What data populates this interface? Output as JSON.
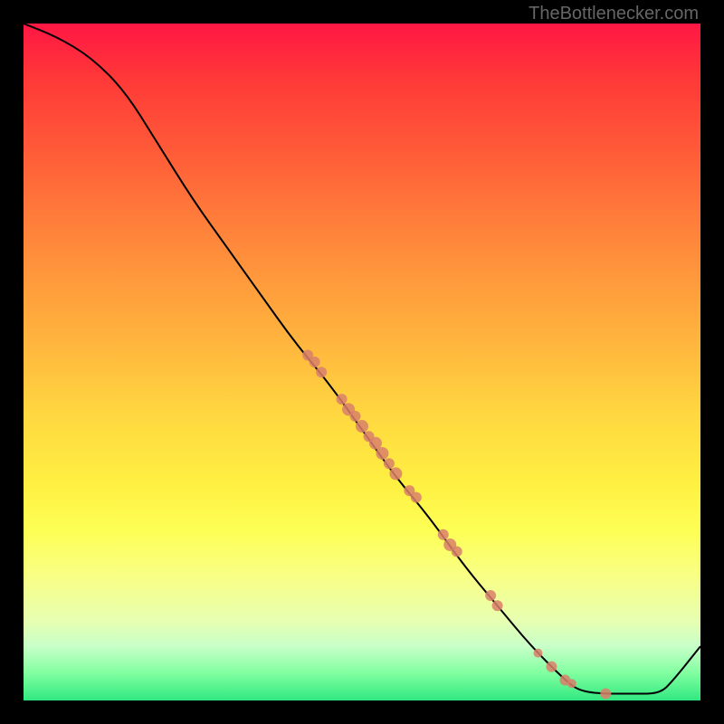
{
  "watermark": "TheBottlenecker.com",
  "chart_data": {
    "type": "line",
    "title": "",
    "xlabel": "",
    "ylabel": "",
    "xlim": [
      0,
      100
    ],
    "ylim": [
      0,
      100
    ],
    "curve": [
      {
        "x": 0,
        "y": 100
      },
      {
        "x": 5,
        "y": 98
      },
      {
        "x": 10,
        "y": 95
      },
      {
        "x": 15,
        "y": 90
      },
      {
        "x": 20,
        "y": 82
      },
      {
        "x": 25,
        "y": 74
      },
      {
        "x": 30,
        "y": 67
      },
      {
        "x": 35,
        "y": 60
      },
      {
        "x": 40,
        "y": 53
      },
      {
        "x": 45,
        "y": 47
      },
      {
        "x": 50,
        "y": 40
      },
      {
        "x": 55,
        "y": 33
      },
      {
        "x": 60,
        "y": 27
      },
      {
        "x": 65,
        "y": 20
      },
      {
        "x": 70,
        "y": 14
      },
      {
        "x": 75,
        "y": 8
      },
      {
        "x": 80,
        "y": 3
      },
      {
        "x": 82,
        "y": 1.5
      },
      {
        "x": 85,
        "y": 1
      },
      {
        "x": 90,
        "y": 1
      },
      {
        "x": 94,
        "y": 1
      },
      {
        "x": 96,
        "y": 3
      },
      {
        "x": 100,
        "y": 8
      }
    ],
    "points": [
      {
        "x": 42,
        "y": 51,
        "r": 6
      },
      {
        "x": 43,
        "y": 50,
        "r": 6
      },
      {
        "x": 44,
        "y": 48.5,
        "r": 6
      },
      {
        "x": 47,
        "y": 44.5,
        "r": 6
      },
      {
        "x": 48,
        "y": 43,
        "r": 7
      },
      {
        "x": 49,
        "y": 42,
        "r": 6
      },
      {
        "x": 50,
        "y": 40.5,
        "r": 7
      },
      {
        "x": 51,
        "y": 39,
        "r": 6
      },
      {
        "x": 52,
        "y": 38,
        "r": 7
      },
      {
        "x": 53,
        "y": 36.5,
        "r": 7
      },
      {
        "x": 54,
        "y": 35,
        "r": 6
      },
      {
        "x": 55,
        "y": 33.5,
        "r": 7
      },
      {
        "x": 57,
        "y": 31,
        "r": 6
      },
      {
        "x": 58,
        "y": 30,
        "r": 6
      },
      {
        "x": 62,
        "y": 24.5,
        "r": 6
      },
      {
        "x": 63,
        "y": 23,
        "r": 7
      },
      {
        "x": 64,
        "y": 22,
        "r": 6
      },
      {
        "x": 69,
        "y": 15.5,
        "r": 6
      },
      {
        "x": 70,
        "y": 14,
        "r": 6
      },
      {
        "x": 76,
        "y": 7,
        "r": 5
      },
      {
        "x": 78,
        "y": 5,
        "r": 6
      },
      {
        "x": 80,
        "y": 3,
        "r": 6
      },
      {
        "x": 81,
        "y": 2.5,
        "r": 5
      },
      {
        "x": 86,
        "y": 1,
        "r": 6
      }
    ],
    "point_color": "#d9806a",
    "curve_color": "#000000"
  }
}
